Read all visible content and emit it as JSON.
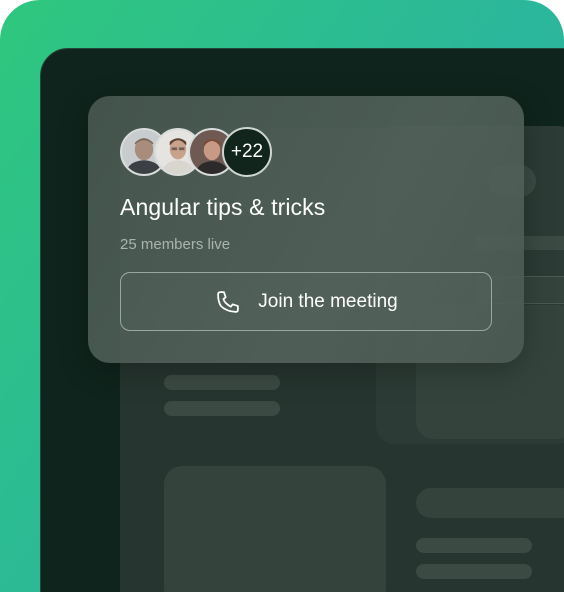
{
  "meeting_card": {
    "title": "Angular tips & tricks",
    "members_live": "25 members live",
    "extra_participants": "+22",
    "join_button_label": "Join the meeting",
    "join_icon": "phone-icon",
    "participants": [
      {
        "avatar": "avatar-1"
      },
      {
        "avatar": "avatar-2"
      },
      {
        "avatar": "avatar-3"
      }
    ]
  },
  "colors": {
    "frame_gradient_start": "#2fc77e",
    "frame_gradient_end": "#2db3a7",
    "device_bg": "#0f241c",
    "card_bg": "#4c5a53",
    "text_primary": "#ffffff",
    "text_secondary": "#a9b4ae"
  }
}
